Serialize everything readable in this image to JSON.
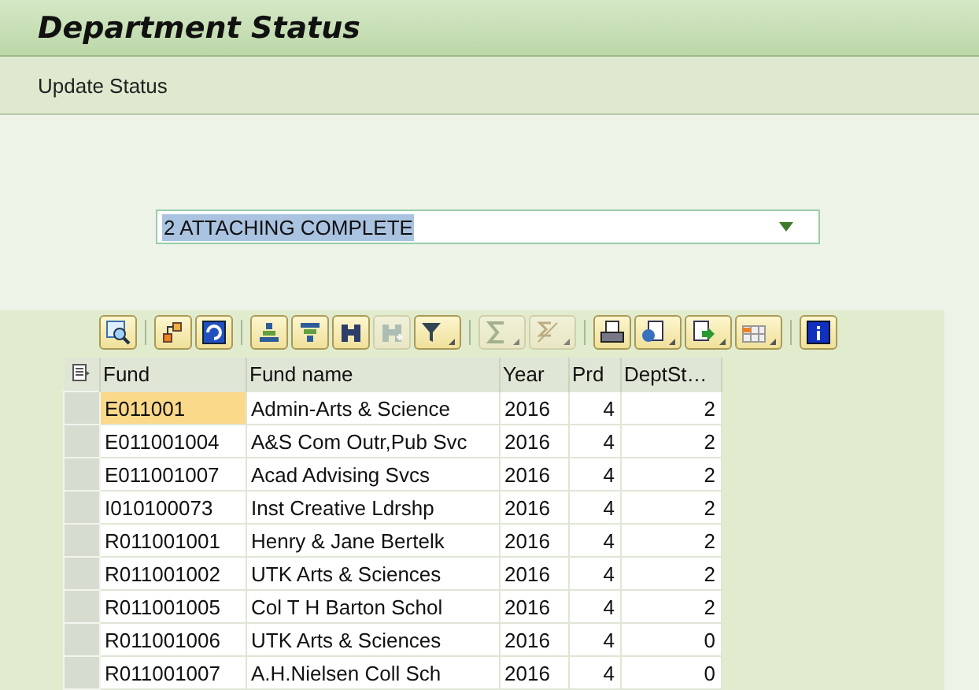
{
  "window": {
    "title": "Department Status"
  },
  "menu": [
    {
      "label": "Update Status"
    }
  ],
  "status_field": {
    "value": "2 ATTACHING COMPLETE",
    "text_selected": true
  },
  "toolbar": [
    [
      {
        "kind": "details",
        "disabled": false,
        "has_menu": false
      }
    ],
    [
      {
        "kind": "tree",
        "disabled": false,
        "has_menu": false
      },
      {
        "kind": "refresh",
        "disabled": false,
        "has_menu": false
      }
    ],
    [
      {
        "kind": "sort-up",
        "disabled": false,
        "has_menu": false
      },
      {
        "kind": "sort-down",
        "disabled": false,
        "has_menu": false
      },
      {
        "kind": "find",
        "disabled": false,
        "has_menu": false
      },
      {
        "kind": "find-next",
        "disabled": true,
        "has_menu": false
      },
      {
        "kind": "filter",
        "disabled": false,
        "has_menu": true
      }
    ],
    [
      {
        "kind": "sum",
        "disabled": true,
        "has_menu": true
      },
      {
        "kind": "subtotal",
        "disabled": true,
        "has_menu": true
      }
    ],
    [
      {
        "kind": "print",
        "disabled": false,
        "has_menu": false
      },
      {
        "kind": "views",
        "disabled": false,
        "has_menu": true
      },
      {
        "kind": "export",
        "disabled": false,
        "has_menu": true
      },
      {
        "kind": "layout",
        "disabled": false,
        "has_menu": true
      }
    ],
    [
      {
        "kind": "info",
        "disabled": false,
        "has_menu": false
      }
    ]
  ],
  "table": {
    "columns": [
      "Fund",
      "Fund name",
      "Year",
      "Prd",
      "DeptSt…"
    ],
    "rows": [
      {
        "cells": [
          "E011001",
          "Admin-Arts & Science",
          "2016",
          "4",
          "2"
        ],
        "focused": true
      },
      {
        "cells": [
          "E011001004",
          "A&S Com Outr,Pub Svc",
          "2016",
          "4",
          "2"
        ],
        "focused": false
      },
      {
        "cells": [
          "E011001007",
          "Acad Advising Svcs",
          "2016",
          "4",
          "2"
        ],
        "focused": false
      },
      {
        "cells": [
          "I010100073",
          "Inst Creative Ldrshp",
          "2016",
          "4",
          "2"
        ],
        "focused": false
      },
      {
        "cells": [
          "R011001001",
          "Henry & Jane Bertelk",
          "2016",
          "4",
          "2"
        ],
        "focused": false
      },
      {
        "cells": [
          "R011001002",
          "UTK Arts & Sciences",
          "2016",
          "4",
          "2"
        ],
        "focused": false
      },
      {
        "cells": [
          "R011001005",
          "Col T H Barton Schol",
          "2016",
          "4",
          "2"
        ],
        "focused": false
      },
      {
        "cells": [
          "R011001006",
          "UTK Arts & Sciences",
          "2016",
          "4",
          "0"
        ],
        "focused": false
      },
      {
        "cells": [
          "R011001007",
          "A.H.Nielsen Coll Sch",
          "2016",
          "4",
          "0"
        ],
        "focused": false
      }
    ]
  }
}
